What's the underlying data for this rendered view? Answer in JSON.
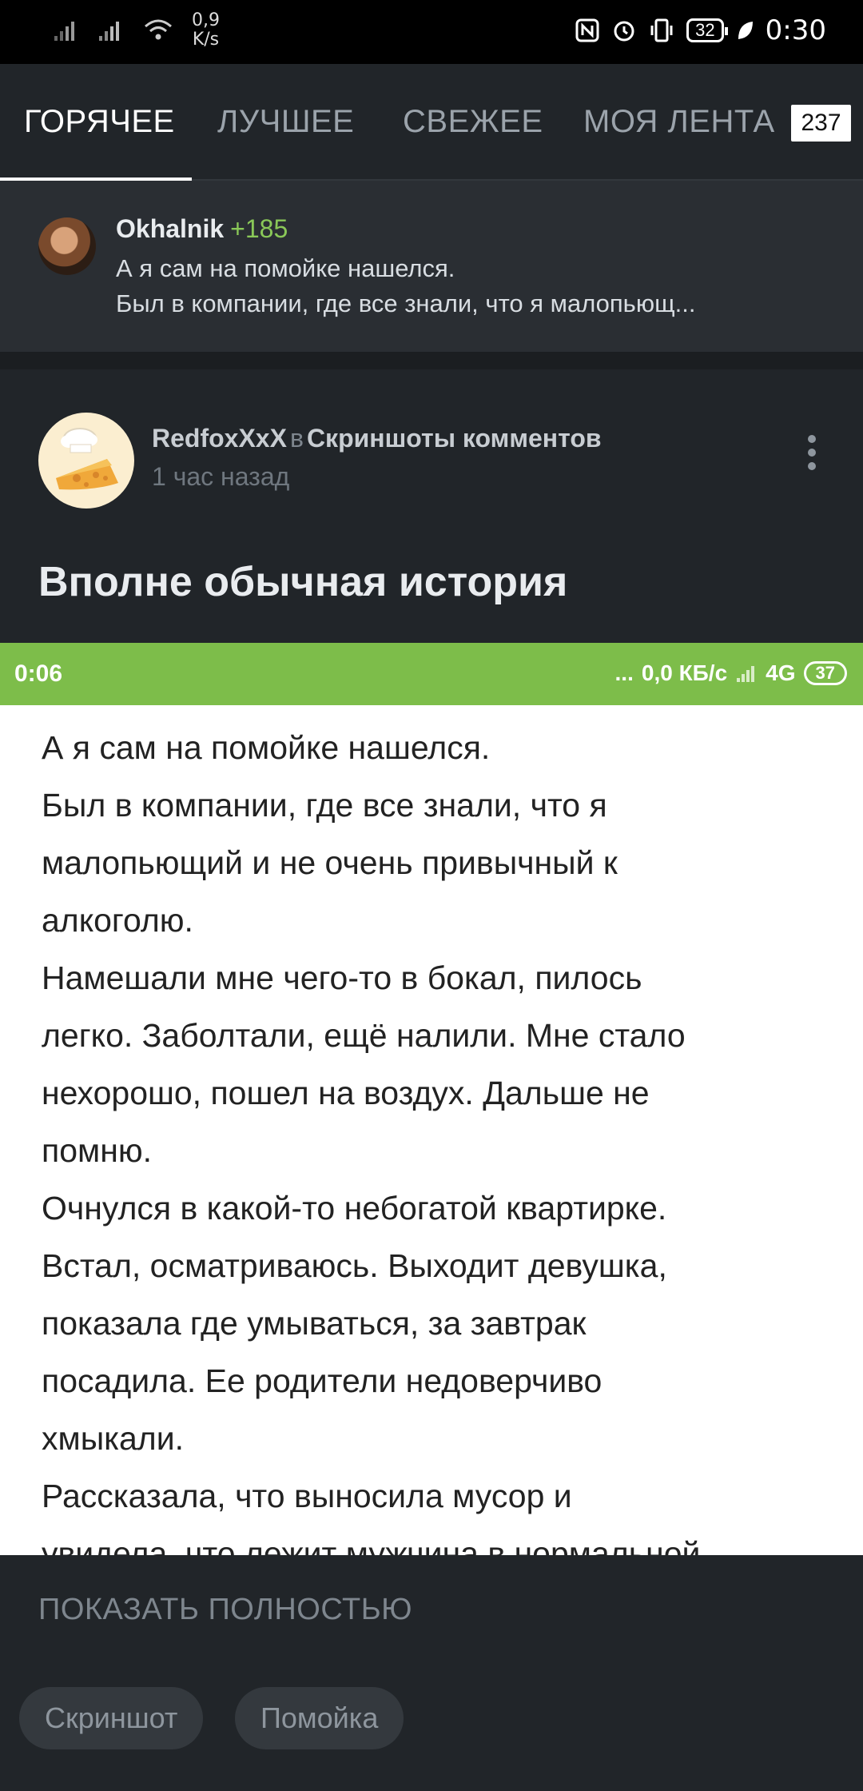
{
  "status_bar": {
    "net_speed_value": "0,9",
    "net_speed_unit": "K/s",
    "battery": "32",
    "time": "0:30"
  },
  "tabs": {
    "items": [
      {
        "label": "ГОРЯЧЕЕ"
      },
      {
        "label": "ЛУЧШЕЕ"
      },
      {
        "label": "СВЕЖЕЕ"
      },
      {
        "label": "МОЯ ЛЕНТА"
      }
    ],
    "badge": "237",
    "active": "ГОРЯЧЕЕ"
  },
  "comment": {
    "user": "Okhalnik",
    "rating": "+185",
    "line1": "А я сам на помойке нашелся.",
    "line2": "Был в компании, где все знали, что я малопьющ..."
  },
  "post": {
    "author": "RedfoxXxX",
    "in_word": "в",
    "community": "Скриншоты комментов",
    "time": "1 час назад",
    "title": "Вполне обычная история"
  },
  "screenshot": {
    "time": "0:06",
    "dots": "...",
    "speed": "0,0 КБ/с",
    "network": "4G",
    "battery": "37",
    "lines": [
      "А я сам на помойке нашелся.",
      "Был в компании, где все знали, что я",
      "малопьющий и не очень привычный к",
      "алкоголю.",
      "Намешали мне чего-то в бокал, пилось",
      "легко. Заболтали, ещё налили. Мне стало",
      "нехорошо, пошел на воздух. Дальше не",
      "помню.",
      "Очнулся в какой-то небогатой квартирке.",
      "Встал, осматриваюсь. Выходит девушка,",
      "показала где умываться, за завтрак",
      "посадила. Ее родители недоверчиво",
      "хмыкали.",
      "Рассказала, что выносила мусор и",
      "увидела, что лежит мужчина в нормальной"
    ]
  },
  "show_full": "ПОКАЗАТЬ ПОЛНОСТЬЮ",
  "tags": [
    {
      "label": "Скриншот"
    },
    {
      "label": "Помойка"
    }
  ],
  "colors": {
    "background": "#212529",
    "accent_green": "#7dbd4a",
    "rating_green": "#8ac858"
  }
}
